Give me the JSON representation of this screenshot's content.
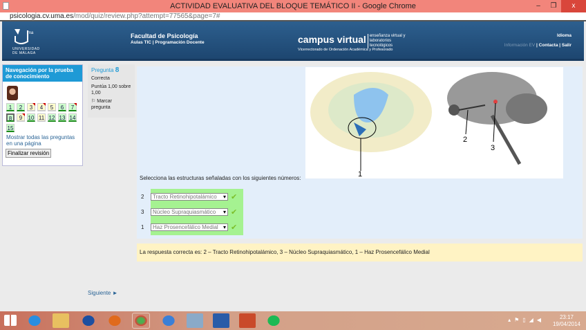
{
  "window": {
    "title": "ACTIVIDAD EVALUATIVA DEL BLOQUE TEMÁTICO II - Google Chrome",
    "minimize": "–",
    "restore": "❐",
    "close": "x"
  },
  "address": {
    "domain": "psicologia.cv.uma.es",
    "path": "/mod/quiz/review.php?attempt=77565&page=7#"
  },
  "header": {
    "logo_text": "UNIVERSIDAD DE MÁLAGA",
    "logo_ma": "ma",
    "faculty": "Facultad de Psicología",
    "faculty_links": "Aulas TIC  |  Programación Docente",
    "campus": "campus virtual",
    "campus_tag": "enseñanza virtual y laboratorios tecnológicos",
    "campus_sub": "Vicerrectorado de Ordenación Académica y Profesorado",
    "idioma": "Idioma",
    "info_ev": "Información EV",
    "contacto": "Contacta",
    "salir": "Salir"
  },
  "nav": {
    "title": "Navegación por la prueba de conocimiento",
    "questions": [
      {
        "n": "1",
        "state": "g",
        "flag": false
      },
      {
        "n": "2",
        "state": "g",
        "flag": false
      },
      {
        "n": "3",
        "state": "y",
        "flag": true
      },
      {
        "n": "4",
        "state": "y",
        "flag": true
      },
      {
        "n": "5",
        "state": "y",
        "flag": false
      },
      {
        "n": "6",
        "state": "g",
        "flag": false
      },
      {
        "n": "7",
        "state": "g",
        "flag": true
      },
      {
        "n": "8",
        "state": "g cur",
        "flag": false
      },
      {
        "n": "9",
        "state": "y",
        "flag": true
      },
      {
        "n": "10",
        "state": "g",
        "flag": false
      },
      {
        "n": "11",
        "state": "y",
        "flag": false
      },
      {
        "n": "12",
        "state": "g",
        "flag": false
      },
      {
        "n": "13",
        "state": "g",
        "flag": false
      },
      {
        "n": "14",
        "state": "g",
        "flag": false
      },
      {
        "n": "15",
        "state": "g",
        "flag": false
      }
    ],
    "show_all": "Mostrar todas las preguntas en una página",
    "finish": "Finalizar revisión"
  },
  "question": {
    "label": "Pregunta",
    "number": "8",
    "status": "Correcta",
    "score": "Puntúa 1,00 sobre 1,00",
    "flag": "Marcar pregunta"
  },
  "content": {
    "prompt": "Selecciona las estructuras señaladas con los siguientes números:",
    "image_labels": [
      "1",
      "2",
      "3"
    ],
    "answers": [
      {
        "n": "2",
        "value": "Tracto Retinohipotalámico"
      },
      {
        "n": "3",
        "value": "Núcleo Supraquiasmático"
      },
      {
        "n": "1",
        "value": "Haz Prosencefálico Medial"
      }
    ],
    "check": "✔",
    "feedback": "La respuesta correcta es: 2 – Tracto Retinohipotalámico, 3 – Núcleo Supraquiasmático, 1 – Haz Prosencefálico Medial"
  },
  "next": "Siguiente ►",
  "tray": {
    "time": "23:17",
    "date": "19/04/2014"
  }
}
